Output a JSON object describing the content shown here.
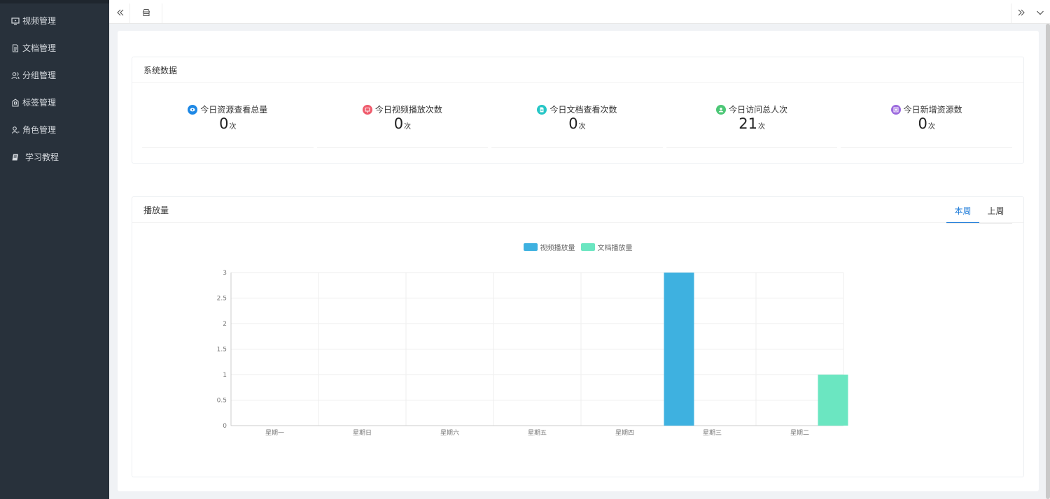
{
  "sidebar": {
    "items": [
      {
        "label": "视频管理",
        "icon": "monitor-icon"
      },
      {
        "label": "文档管理",
        "icon": "document-icon"
      },
      {
        "label": "分组管理",
        "icon": "users-icon"
      },
      {
        "label": "标签管理",
        "icon": "tag-icon"
      },
      {
        "label": "角色管理",
        "icon": "user-icon"
      },
      {
        "label": "学习教程",
        "icon": "book-icon"
      }
    ]
  },
  "system": {
    "title": "系统数据",
    "stats": [
      {
        "label": "今日资源查看总量",
        "value": "0",
        "unit": "次",
        "color": "#1e88e5",
        "icon": "eye-icon"
      },
      {
        "label": "今日视频播放次数",
        "value": "0",
        "unit": "次",
        "color": "#ef5b6c",
        "icon": "video-icon"
      },
      {
        "label": "今日文档查看次数",
        "value": "0",
        "unit": "次",
        "color": "#26c6c6",
        "icon": "file-icon"
      },
      {
        "label": "今日访问总人次",
        "value": "21",
        "unit": "次",
        "color": "#4cc776",
        "icon": "person-icon"
      },
      {
        "label": "今日新增资源数",
        "value": "0",
        "unit": "次",
        "color": "#9c6ade",
        "icon": "resource-icon"
      }
    ]
  },
  "playback": {
    "title": "播放量",
    "tabs": [
      {
        "label": "本周",
        "active": true
      },
      {
        "label": "上周",
        "active": false
      }
    ]
  },
  "chart_data": {
    "type": "bar",
    "categories": [
      "星期一",
      "星期日",
      "星期六",
      "星期五",
      "星期四",
      "星期三",
      "星期二"
    ],
    "series": [
      {
        "name": "视频播放量",
        "values": [
          0,
          0,
          0,
          0,
          0,
          3,
          0
        ],
        "color": "#3eb1e0"
      },
      {
        "name": "文档播放量",
        "values": [
          0,
          0,
          0,
          0,
          0,
          0,
          1
        ],
        "color": "#6be6c1"
      }
    ],
    "yticks": [
      "0",
      "0.5",
      "1",
      "1.5",
      "2",
      "2.5",
      "3"
    ],
    "ylim": [
      0,
      3
    ],
    "grid": true,
    "legend": "top-center"
  }
}
